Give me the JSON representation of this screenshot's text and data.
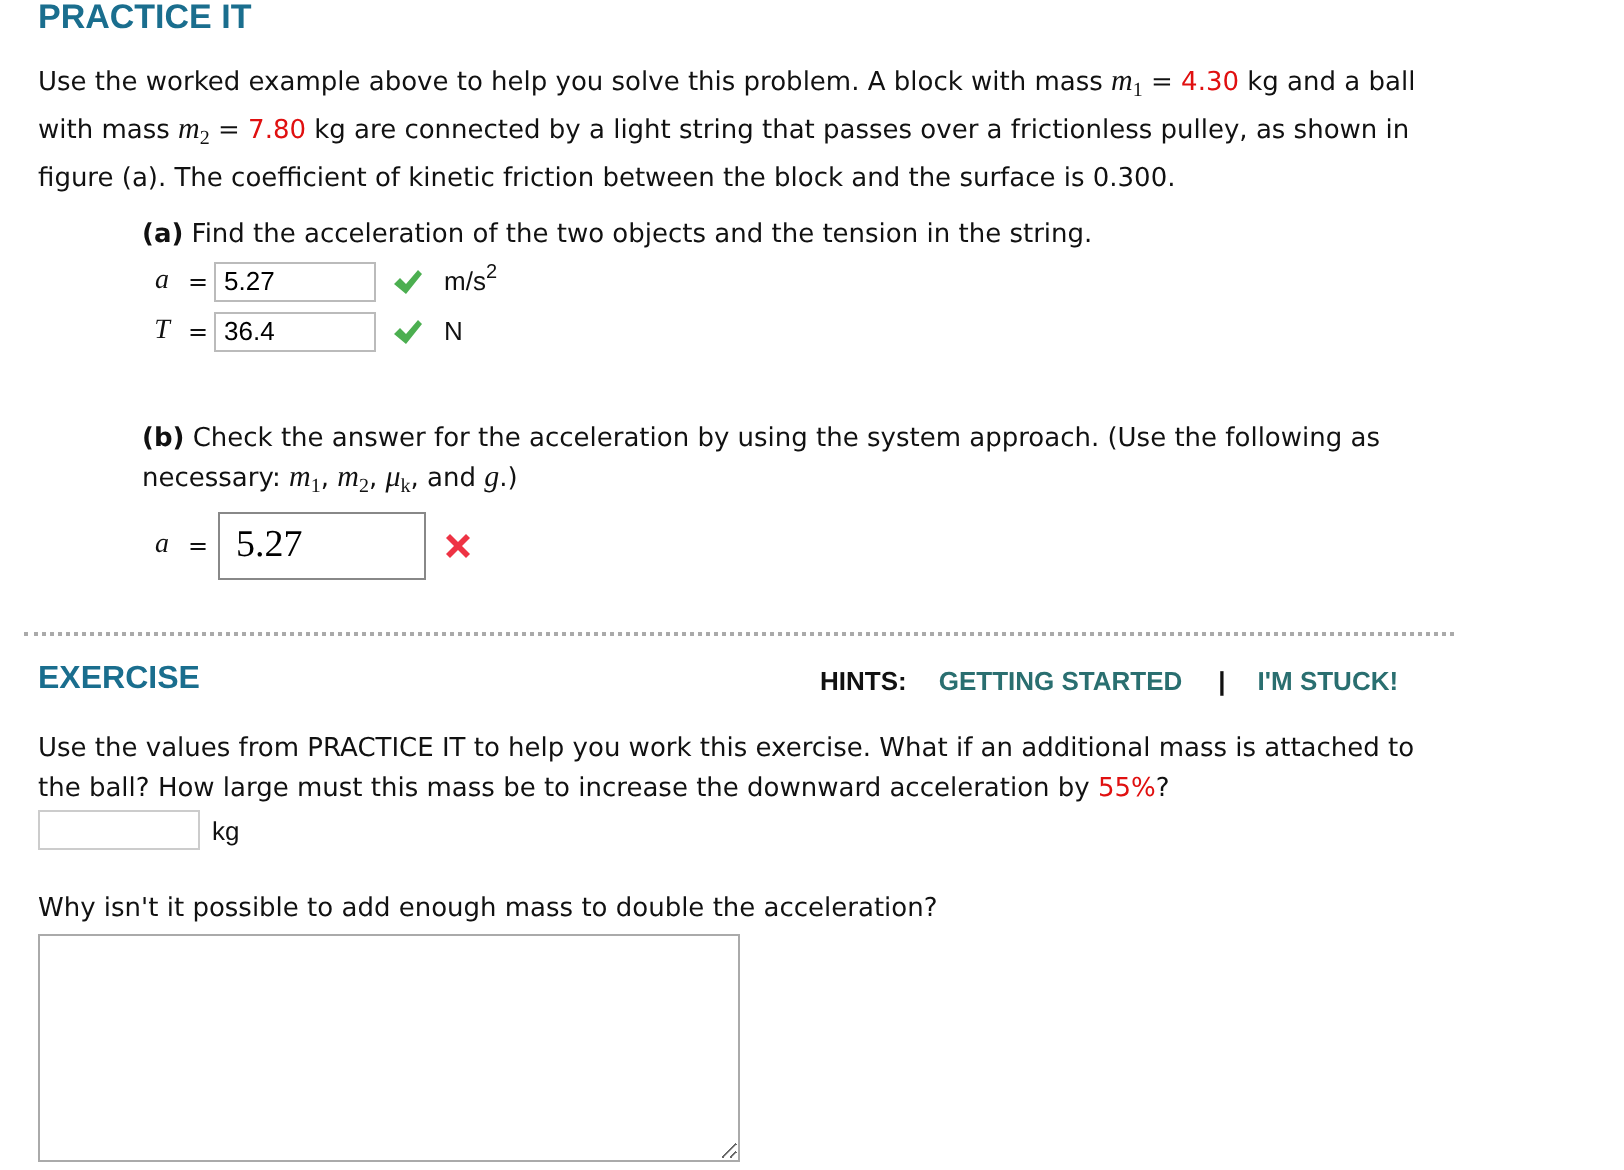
{
  "practice": {
    "title": "PRACTICE IT",
    "intro": [
      {
        "kind": "text",
        "text": "Use the worked example above to help you solve this problem. A block with mass "
      },
      {
        "kind": "math",
        "text": "m$_{1}$"
      },
      {
        "kind": "text",
        "text": " = "
      },
      {
        "kind": "value",
        "text": "4.30"
      },
      {
        "kind": "text",
        "text": " kg and a ball with mass "
      },
      {
        "kind": "math",
        "text": "m$_{2}$"
      },
      {
        "kind": "text",
        "text": " = "
      },
      {
        "kind": "value",
        "text": "7.80"
      },
      {
        "kind": "text",
        "text": " kg are connected by a light string that passes over a frictionless pulley, as shown in figure (a). The coefficient of kinetic friction between the block and the surface is 0.300."
      }
    ]
  },
  "part_a": {
    "prompt": "**(a)** Find the acceleration of the two objects and the tension in the string.",
    "answers": [
      {
        "variable": "a",
        "relation": "=",
        "value": "5.27",
        "correct": true,
        "unit": "m/s$^{2}$"
      },
      {
        "variable": "T",
        "relation": "=",
        "value": "36.4",
        "correct": true,
        "unit": "N"
      }
    ]
  },
  "part_b": {
    "prompt": [
      {
        "kind": "text",
        "text": "**(b)** Check the answer for the acceleration by using the system approach. (Use the following as necessary: "
      },
      {
        "kind": "math",
        "text": "m$_{1}$"
      },
      {
        "kind": "text",
        "text": ", "
      },
      {
        "kind": "math",
        "text": "m$_{2}$"
      },
      {
        "kind": "text",
        "text": ", "
      },
      {
        "kind": "math",
        "text": "μ$_{k}$"
      },
      {
        "kind": "text",
        "text": ", and "
      },
      {
        "kind": "math",
        "text": "g"
      },
      {
        "kind": "text",
        "text": ".)"
      }
    ],
    "answer": {
      "variable": "a",
      "relation": "=",
      "value": "5.27",
      "correct": false
    }
  },
  "exercise": {
    "title": "EXERCISE",
    "hints_label": "HINTS:",
    "hints": [
      "GETTING STARTED",
      "I'M STUCK!"
    ],
    "separator": "|",
    "question": [
      {
        "kind": "text",
        "text": "Use the values from PRACTICE IT to help you work this exercise. What if an additional mass is attached to the ball? How large must this mass be to increase the downward acceleration by "
      },
      {
        "kind": "value",
        "text": "55%"
      },
      {
        "kind": "text",
        "text": "?"
      }
    ],
    "answer_unit": "kg",
    "question_2": "Why isn't it possible to add enough mass to double the acceleration?"
  }
}
